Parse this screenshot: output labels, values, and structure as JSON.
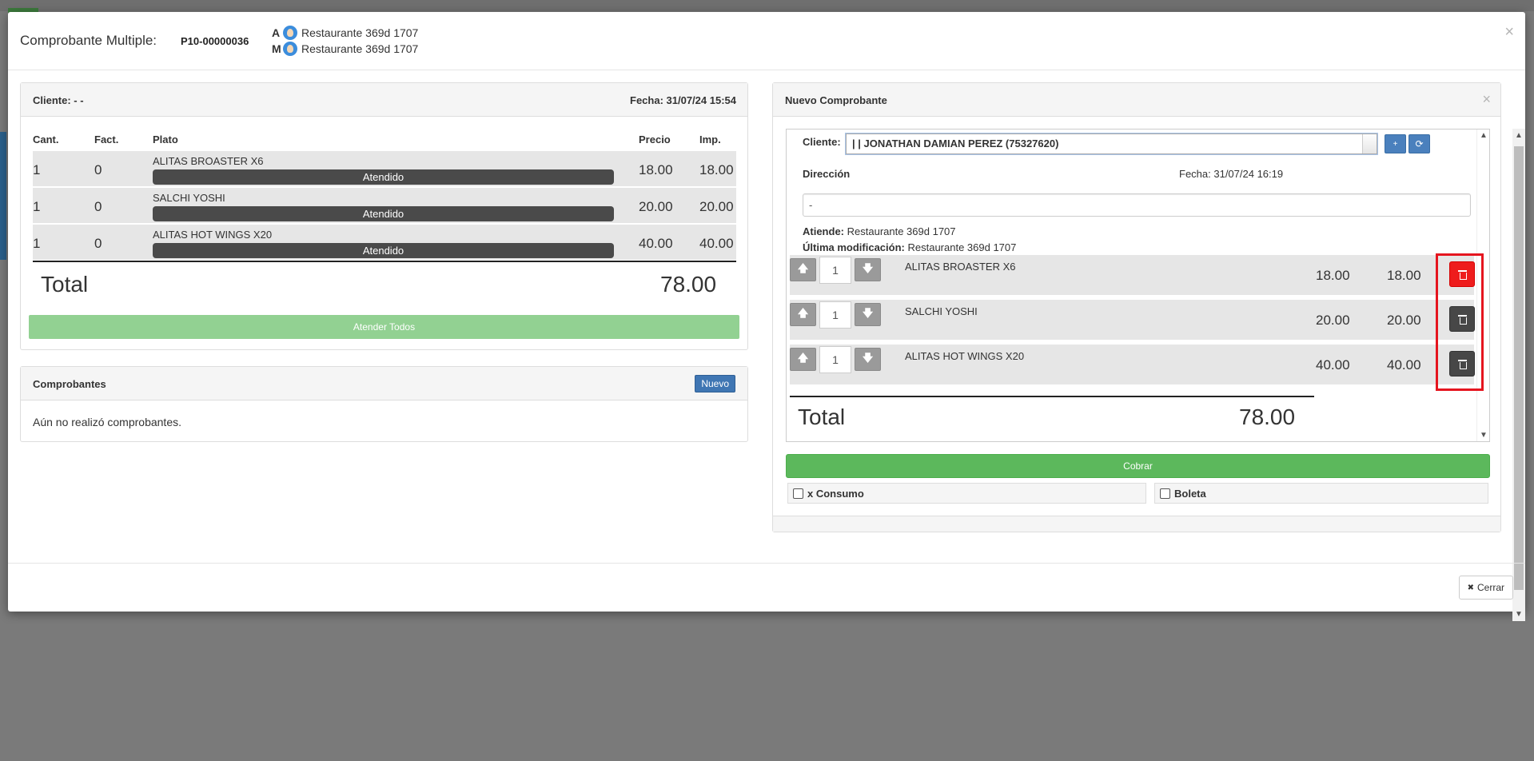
{
  "header": {
    "title": "Comprobante Multiple:",
    "code": "P10-00000036",
    "users": [
      {
        "letter": "A",
        "name": "Restaurante 369d 1707"
      },
      {
        "letter": "M",
        "name": "Restaurante 369d 1707"
      }
    ],
    "close_glyph": "×"
  },
  "left_panel": {
    "cliente": "Cliente: - -",
    "fecha": "Fecha: 31/07/24 15:54",
    "columns": [
      "Cant.",
      "Fact.",
      "Plato",
      "Precio",
      "Imp."
    ],
    "rows": [
      {
        "cant": "1",
        "fact": "0",
        "plato": "ALITAS BROASTER X6",
        "status": "Atendido",
        "precio": "18.00",
        "imp": "18.00"
      },
      {
        "cant": "1",
        "fact": "0",
        "plato": "SALCHI YOSHI",
        "status": "Atendido",
        "precio": "20.00",
        "imp": "20.00"
      },
      {
        "cant": "1",
        "fact": "0",
        "plato": "ALITAS HOT WINGS X20",
        "status": "Atendido",
        "precio": "40.00",
        "imp": "40.00"
      }
    ],
    "total_label": "Total",
    "total_value": "78.00",
    "atender_label": "Atender Todos"
  },
  "comprobantes": {
    "title": "Comprobantes",
    "nuevo_label": "Nuevo",
    "empty_text": "Aún no realizó comprobantes."
  },
  "right_panel": {
    "title": "Nuevo Comprobante",
    "close_glyph": "×",
    "cliente_label": "Cliente:",
    "cliente_value": "| | JONATHAN DAMIAN PEREZ (75327620)",
    "direccion_label": "Dirección",
    "fecha": "Fecha: 31/07/24 16:19",
    "direccion_value": "-",
    "atiende_label": "Atiende:",
    "atiende_value": "Restaurante 369d 1707",
    "ultima_label": "Última modificación:",
    "ultima_value": "Restaurante 369d 1707",
    "items": [
      {
        "qty": "1",
        "name": "ALITAS BROASTER X6",
        "precio": "18.00",
        "imp": "18.00"
      },
      {
        "qty": "1",
        "name": "SALCHI YOSHI",
        "precio": "20.00",
        "imp": "20.00"
      },
      {
        "qty": "1",
        "name": "ALITAS HOT WINGS X20",
        "precio": "40.00",
        "imp": "40.00"
      }
    ],
    "total_label": "Total",
    "total_value": "78.00",
    "cobrar_label": "Cobrar",
    "consumo_label": "x Consumo",
    "boleta_label": "Boleta"
  },
  "footer": {
    "cerrar_label": "Cerrar",
    "cerrar_icon": "✖"
  },
  "icons": {
    "up": "🡅",
    "down": "🡇",
    "scroll_up": "▲",
    "scroll_down": "▼",
    "add_user": "👤",
    "refresh": "⟳"
  },
  "colors": {
    "atender": "#92d192",
    "cobrar": "#5cb85c",
    "nuevo": "#3f76b3",
    "trash_active": "#ee1c1c",
    "highlight": "#e5151f"
  }
}
